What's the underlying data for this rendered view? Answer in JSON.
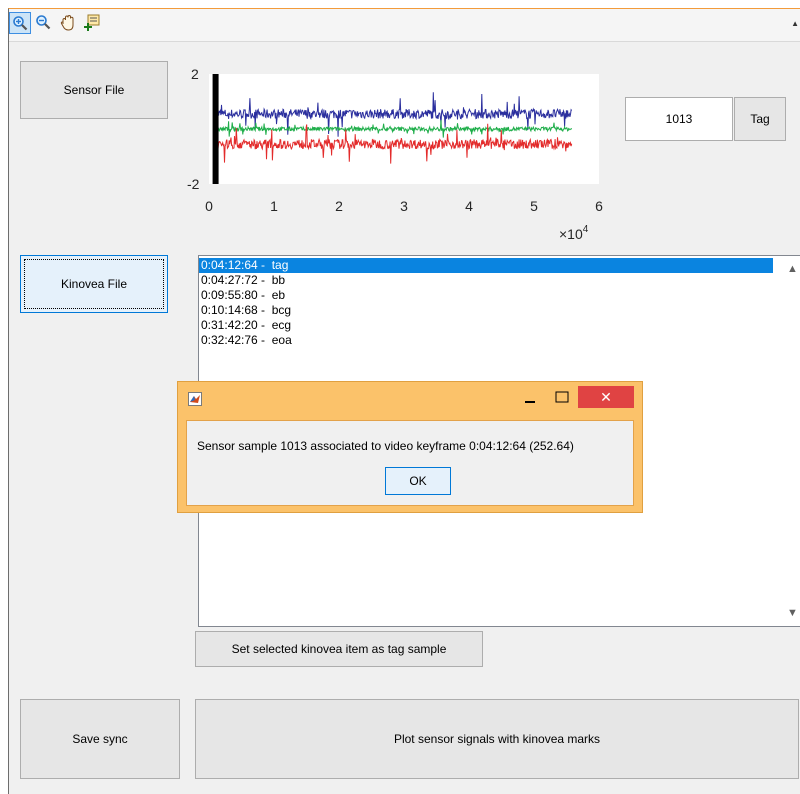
{
  "toolbar": {
    "tools": [
      {
        "icon": "zoom-in-icon",
        "active": true
      },
      {
        "icon": "zoom-out-icon",
        "active": false
      },
      {
        "icon": "pan-hand-icon",
        "active": false
      },
      {
        "icon": "data-cursor-icon",
        "active": false
      }
    ]
  },
  "buttons": {
    "sensor_file": "Sensor File",
    "kinovea_file": "Kinovea File",
    "tag": "Tag",
    "set_selected": "Set selected kinovea item as tag sample",
    "save_sync": "Save sync",
    "plot_signals": "Plot sensor signals with kinovea marks"
  },
  "tag_value": "1013",
  "chart_data": {
    "type": "line",
    "xlim": [
      0,
      60000
    ],
    "ylim": [
      -2,
      2
    ],
    "xticks": [
      "0",
      "1",
      "2",
      "3",
      "4",
      "5",
      "6"
    ],
    "yticks": [
      "2",
      "-2"
    ],
    "x_exponent_label": "×10",
    "x_exponent_power": "4",
    "marker_x": 1013,
    "series": [
      {
        "color": "#2b2f9e",
        "baseline": 0.55,
        "noise": 0.35
      },
      {
        "color": "#1fae4a",
        "baseline": 0.0,
        "noise": 0.15
      },
      {
        "color": "#e32b2b",
        "baseline": -0.55,
        "noise": 0.35
      }
    ]
  },
  "kinovea_list": {
    "items": [
      "0:04:12:64 -  tag",
      "0:04:27:72 -  bb",
      "0:09:55:80 -  eb",
      "0:10:14:68 -  bcg",
      "0:31:42:20 -  ecg",
      "0:32:42:76 -  eoa"
    ],
    "selected_index": 0
  },
  "dialog": {
    "message": "Sensor sample 1013 associated to video keyframe 0:04:12:64 (252.64)",
    "ok_label": "OK",
    "close_glyph": "✕"
  }
}
